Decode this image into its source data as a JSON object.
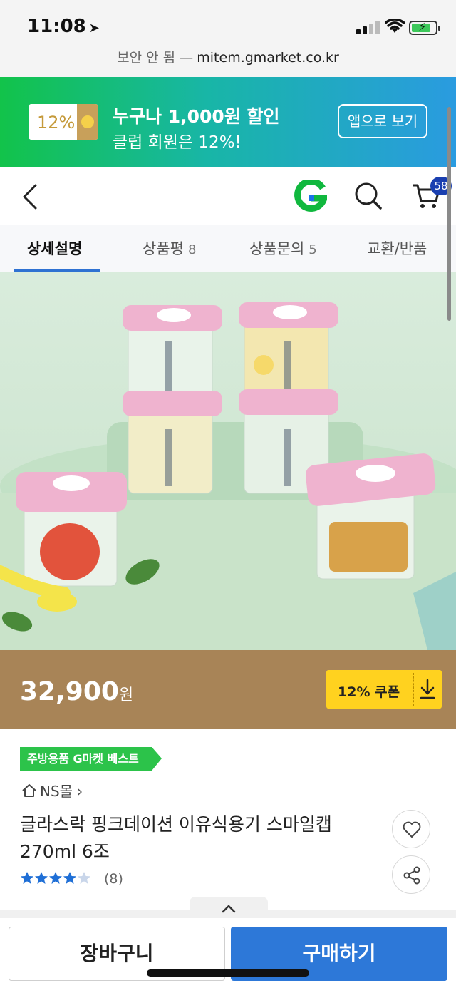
{
  "status_bar": {
    "time": "11:08"
  },
  "address_bar": {
    "security": "보안 안 됨 —",
    "domain": "mitem.gmarket.co.kr"
  },
  "promo_banner": {
    "badge": "12%",
    "line1": "누구나 1,000원 할인",
    "line2": "클럽 회원은 12%!",
    "app_button": "앱으로 보기"
  },
  "header": {
    "cart_count": "58"
  },
  "tabs": [
    {
      "label": "상세설명",
      "count": ""
    },
    {
      "label": "상품평",
      "count": "8"
    },
    {
      "label": "상품문의",
      "count": "5"
    },
    {
      "label": "교환/반품",
      "count": ""
    }
  ],
  "price": {
    "amount": "32,900",
    "unit": "원",
    "coupon_label": "12% 쿠폰"
  },
  "product": {
    "best_tag": "주방용품 G마켓 베스트",
    "store": "NS몰",
    "title": "글라스락 핑크데이션 이유식용기 스마일캡 270ml 6조",
    "rating": 4.7,
    "review_count": "(8)"
  },
  "actions": {
    "cart": "장바구니",
    "buy": "구매하기"
  },
  "colors": {
    "brand_green": "#12c34a",
    "buy_blue": "#2d78d8",
    "coupon_yellow": "#ffd21f",
    "price_bg": "#a88457"
  }
}
